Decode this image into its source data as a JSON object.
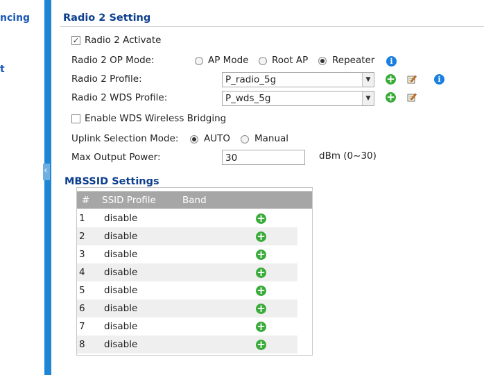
{
  "nav": {
    "items": [
      {
        "label": "ncing"
      },
      {
        "label": "t"
      }
    ]
  },
  "radio2": {
    "title": "Radio 2 Setting",
    "activate_label": "Radio 2 Activate",
    "activate_checked": true,
    "op_mode": {
      "label": "Radio 2 OP Mode:",
      "options": [
        "AP Mode",
        "Root AP",
        "Repeater"
      ],
      "selected": "Repeater"
    },
    "profile": {
      "label": "Radio 2 Profile:",
      "value": "P_radio_5g"
    },
    "wds_profile": {
      "label": "Radio 2 WDS Profile:",
      "value": "P_wds_5g"
    },
    "wds_bridging": {
      "label": "Enable WDS Wireless Bridging",
      "checked": false
    },
    "uplink": {
      "label": "Uplink Selection Mode:",
      "options": [
        "AUTO",
        "Manual"
      ],
      "selected": "AUTO"
    },
    "max_power": {
      "label": "Max Output Power:",
      "value": "30",
      "unit": "dBm (0~30)"
    }
  },
  "mbssid": {
    "title": "MBSSID Settings",
    "columns": [
      "#",
      "SSID Profile",
      "Band"
    ],
    "rows": [
      {
        "num": "1",
        "profile": "disable"
      },
      {
        "num": "2",
        "profile": "disable"
      },
      {
        "num": "3",
        "profile": "disable"
      },
      {
        "num": "4",
        "profile": "disable"
      },
      {
        "num": "5",
        "profile": "disable"
      },
      {
        "num": "6",
        "profile": "disable"
      },
      {
        "num": "7",
        "profile": "disable"
      },
      {
        "num": "8",
        "profile": "disable"
      }
    ]
  },
  "colors": {
    "accent_bar": "#1f86d6",
    "section_title": "#0d3f8f",
    "add_icon": "#3aab3a",
    "info_icon": "#1a7fe0",
    "table_header": "#a6a6a6"
  },
  "icons": {
    "info": "i",
    "add": "+",
    "edit": "pencil-note",
    "checkmark": "✓",
    "select_arrow": "▼",
    "collapse": "‹"
  }
}
